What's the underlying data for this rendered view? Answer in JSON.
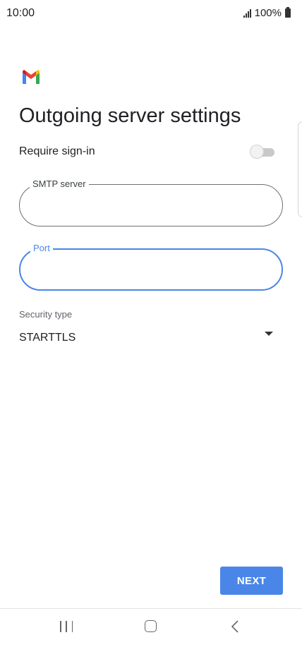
{
  "status_bar": {
    "time": "10:00",
    "battery": "100%",
    "icons": [
      "signal-icon",
      "battery-icon"
    ]
  },
  "app": {
    "logo": "gmail-logo-icon",
    "colors": {
      "accent": "#4a86e8",
      "text": "#202124",
      "gmail_red": "#ea4335",
      "gmail_blue": "#4285f4",
      "gmail_green": "#34a853",
      "gmail_yellow": "#fbbc04"
    }
  },
  "page": {
    "title": "Outgoing server settings"
  },
  "require_signin": {
    "label": "Require sign-in",
    "enabled": false
  },
  "smtp_server": {
    "label": "SMTP server",
    "value": ""
  },
  "port": {
    "label": "Port",
    "value": ""
  },
  "security": {
    "label": "Security type",
    "selected": "STARTTLS"
  },
  "actions": {
    "next_label": "NEXT"
  },
  "nav_bar": {
    "icons": [
      "recents-icon",
      "home-icon",
      "back-icon"
    ]
  }
}
